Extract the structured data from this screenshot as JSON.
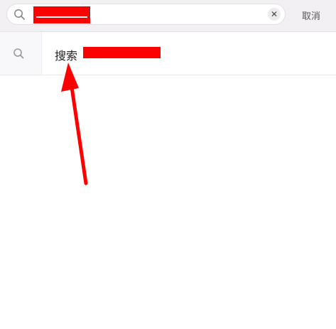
{
  "search": {
    "value": "",
    "clear_symbol": "✕",
    "cancel_label": "取消"
  },
  "suggestion": {
    "prefix": "搜索",
    "query": ""
  },
  "icons": {
    "search": "search-icon",
    "clear": "clear-icon"
  },
  "colors": {
    "redaction": "#ff0000",
    "annotation_arrow": "#ff0000",
    "topbar_bg": "#f2f0f3"
  }
}
